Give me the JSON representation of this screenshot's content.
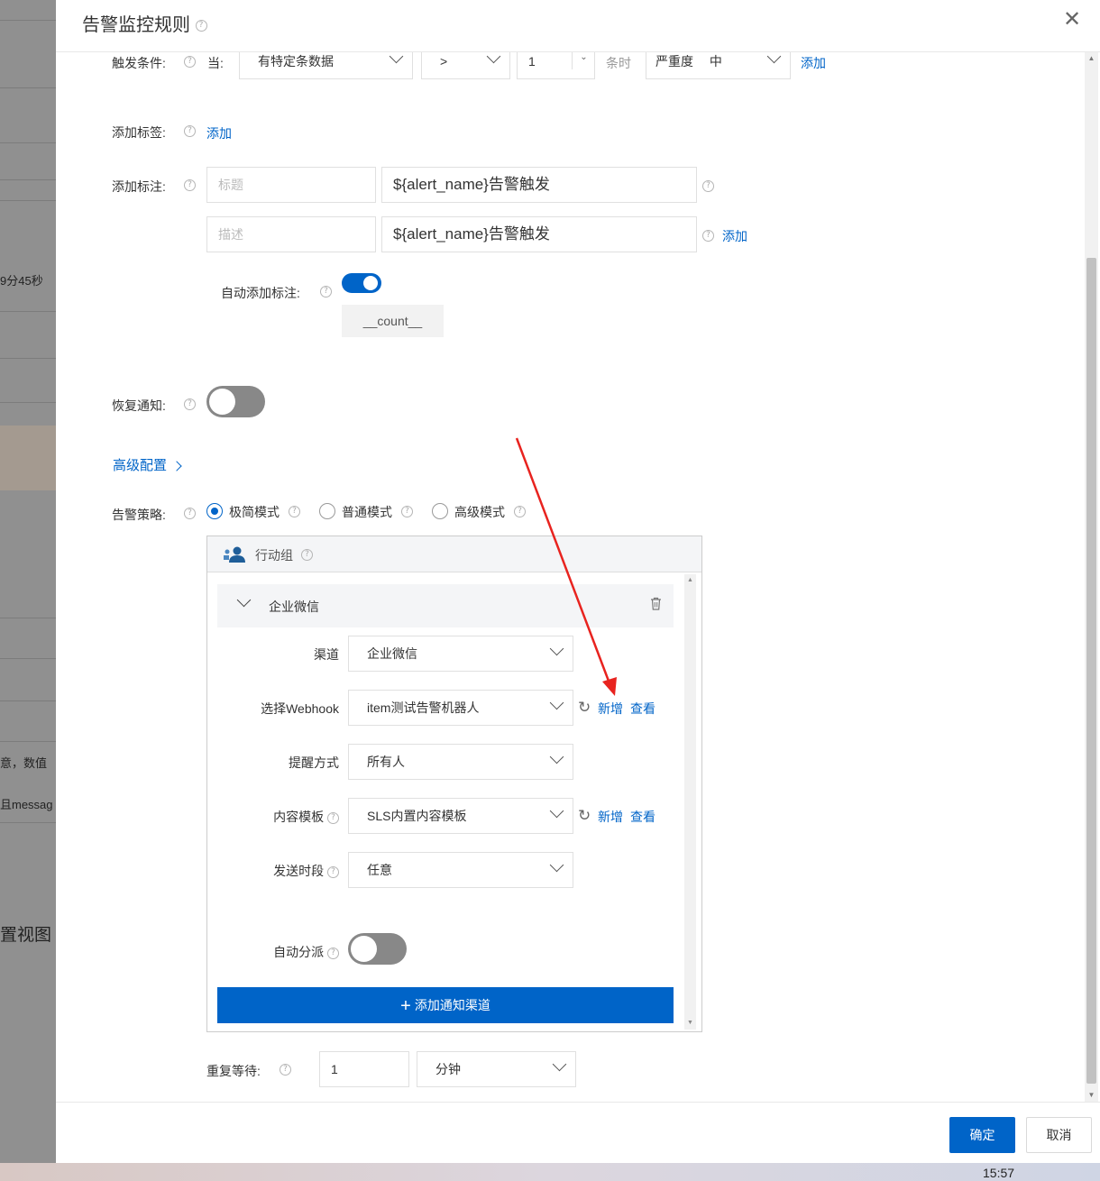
{
  "background": {
    "fragment_duration": "9分45秒",
    "fragment_note1": "意，数值",
    "fragment_note2": "且messag",
    "fragment_view": "置视图"
  },
  "dialog": {
    "title": "告警监控规则",
    "close_icon": "close-icon"
  },
  "trigger": {
    "label": "触发条件:",
    "when": "当:",
    "condition": "有特定条数据",
    "operator": ">",
    "count": "1",
    "count_unit": "条时",
    "severity_label": "严重度",
    "severity_value": "中",
    "add": "添加"
  },
  "labels": {
    "label": "添加标签:",
    "add": "添加"
  },
  "annotations": {
    "label": "添加标注:",
    "rows": [
      {
        "key_placeholder": "标题",
        "value": "${alert_name}告警触发"
      },
      {
        "key_placeholder": "描述",
        "value": "${alert_name}告警触发"
      }
    ],
    "add": "添加",
    "auto_label": "自动添加标注:",
    "auto_enabled": true,
    "auto_tag": "__count__"
  },
  "recovery": {
    "label": "恢复通知:",
    "enabled": false
  },
  "advanced": {
    "label": "高级配置"
  },
  "strategy": {
    "label": "告警策略:",
    "modes": [
      "极简模式",
      "普通模式",
      "高级模式"
    ],
    "selected": "极简模式"
  },
  "action_group": {
    "title": "行动组",
    "channel_title": "企业微信",
    "fields": {
      "channel_label": "渠道",
      "channel_value": "企业微信",
      "webhook_label": "选择Webhook",
      "webhook_value": "item测试告警机器人",
      "remind_label": "提醒方式",
      "remind_value": "所有人",
      "template_label": "内容模板",
      "template_value": "SLS内置内容模板",
      "period_label": "发送时段",
      "period_value": "任意",
      "dispatch_label": "自动分派"
    },
    "new": "新增",
    "view": "查看",
    "add_channel": "添加通知渠道",
    "auto_dispatch": false
  },
  "repeat": {
    "label": "重复等待:",
    "value": "1",
    "unit": "分钟"
  },
  "footer": {
    "ok": "确定",
    "cancel": "取消"
  },
  "taskbar": {
    "time": "15:57"
  },
  "colors": {
    "primary": "#0064c8",
    "annotation_arrow": "#e8231f"
  }
}
